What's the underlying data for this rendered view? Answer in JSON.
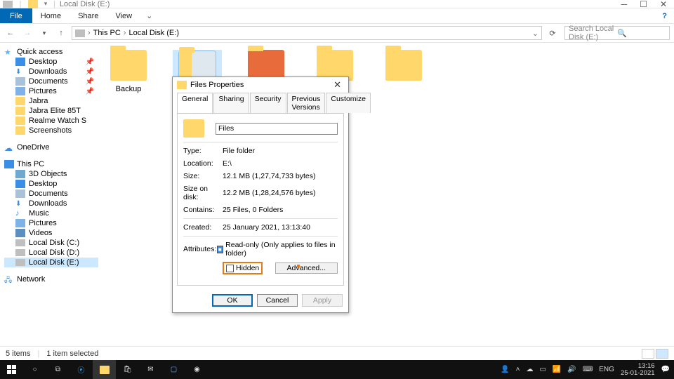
{
  "titlebar": {
    "title": "Local Disk (E:)"
  },
  "ribbon": {
    "file": "File",
    "tabs": [
      "Home",
      "Share",
      "View"
    ]
  },
  "breadcrumb": {
    "pc": "This PC",
    "drive": "Local Disk (E:)"
  },
  "search": {
    "placeholder": "Search Local Disk (E:)"
  },
  "nav": {
    "quick": "Quick access",
    "quick_items": [
      "Desktop",
      "Downloads",
      "Documents",
      "Pictures",
      "Jabra",
      "Jabra Elite 85T",
      "Realme Watch S",
      "Screenshots"
    ],
    "onedrive": "OneDrive",
    "thispc": "This PC",
    "pc_items": [
      "3D Objects",
      "Desktop",
      "Documents",
      "Downloads",
      "Music",
      "Pictures",
      "Videos",
      "Local Disk (C:)",
      "Local Disk (D:)",
      "Local Disk (E:)"
    ],
    "network": "Network"
  },
  "folders": [
    "Backup",
    "Files",
    "",
    "",
    ""
  ],
  "dialog": {
    "title": "Files Properties",
    "tabs": [
      "General",
      "Sharing",
      "Security",
      "Previous Versions",
      "Customize"
    ],
    "name": "Files",
    "rows": {
      "type_l": "Type:",
      "type_v": "File folder",
      "loc_l": "Location:",
      "loc_v": "E:\\",
      "size_l": "Size:",
      "size_v": "12.1 MB (1,27,74,733 bytes)",
      "sod_l": "Size on disk:",
      "sod_v": "12.2 MB (1,28,24,576 bytes)",
      "cont_l": "Contains:",
      "cont_v": "25 Files, 0 Folders",
      "created_l": "Created:",
      "created_v": "25 January 2021, 13:13:40",
      "attr_l": "Attributes:",
      "readonly": "Read-only (Only applies to files in folder)",
      "hidden": "Hidden",
      "advanced": "Advanced..."
    },
    "buttons": {
      "ok": "OK",
      "cancel": "Cancel",
      "apply": "Apply"
    }
  },
  "status": {
    "count": "5 items",
    "sel": "1 item selected"
  },
  "tray": {
    "lang": "ENG",
    "time": "13:16",
    "date": "25-01-2021"
  }
}
